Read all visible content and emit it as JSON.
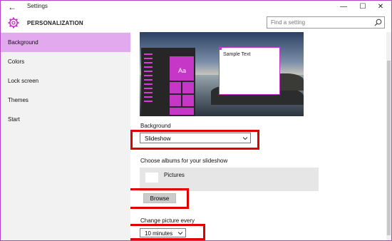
{
  "window": {
    "title": "Settings",
    "minimize": "—",
    "maximize": "☐",
    "close": "✕",
    "back": "←"
  },
  "header": {
    "title": "PERSONALIZATION",
    "icon": "gear-icon"
  },
  "search": {
    "placeholder": "Find a setting",
    "value": ""
  },
  "sidebar": {
    "items": [
      {
        "label": "Background",
        "active": true
      },
      {
        "label": "Colors",
        "active": false
      },
      {
        "label": "Lock screen",
        "active": false
      },
      {
        "label": "Themes",
        "active": false
      },
      {
        "label": "Start",
        "active": false
      }
    ]
  },
  "preview": {
    "tile_label": "Aa",
    "sample_text": "Sample Text"
  },
  "background": {
    "label": "Background",
    "value": "Slideshow"
  },
  "albums": {
    "label": "Choose albums for your slideshow",
    "item": "Pictures",
    "browse_label": "Browse"
  },
  "interval": {
    "label": "Change picture every",
    "value": "10 minutes"
  },
  "colors": {
    "accent": "#c737c7",
    "sidebar_active": "#e3a9ee",
    "highlight": "#e00000",
    "window_border": "#b146c2"
  }
}
